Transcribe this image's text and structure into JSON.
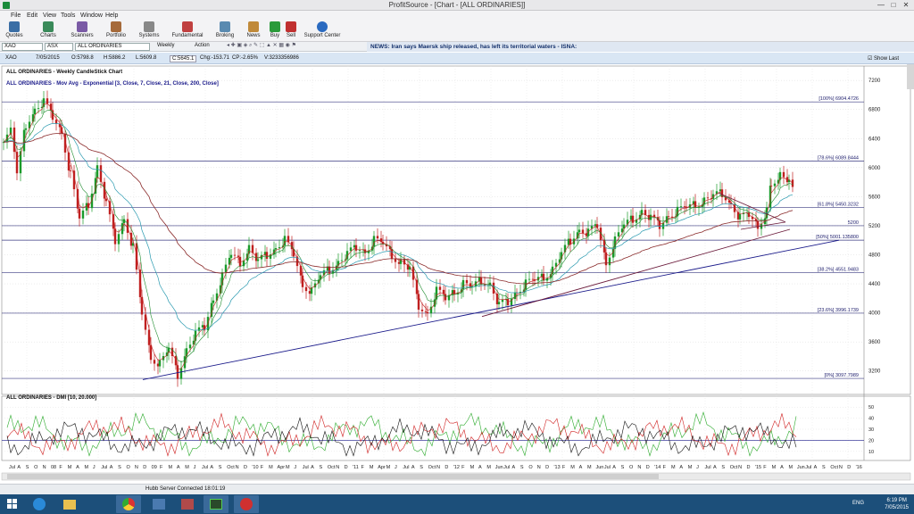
{
  "window": {
    "title": "ProfitSource - [Chart - [ALL ORDINARIES]]",
    "minimize": "—",
    "maximize": "□",
    "close": "✕"
  },
  "menu": [
    "File",
    "Edit",
    "View",
    "Tools",
    "Window",
    "Help"
  ],
  "toolbar": [
    "Quotes",
    "Charts",
    "Scanners",
    "Portfolio",
    "Systems",
    "Fundamental",
    "Broking",
    "News",
    "Buy",
    "Sell",
    "Support Center"
  ],
  "symbol_bar": {
    "symbol": "XAO",
    "exchange": "ASX",
    "name": "ALL ORDINARIES",
    "period": "Weekly",
    "action": "Action"
  },
  "news": "NEWS: Iran says Maersk ship released, has left its territorial waters - ISNA:",
  "infobar": {
    "symbol": "XAO",
    "date": "7/05/2015",
    "open": "O:5798.8",
    "high": "H:5886.2",
    "low": "L:5609.8",
    "close": "C:5645.1",
    "chg": "Chg:-153.71",
    "chgp": "CP:-2.65%",
    "vol": "V:3233356986",
    "show_last": "Show Last"
  },
  "chart_data": {
    "type": "candlestick",
    "title": "ALL ORDINARIES - Weekly CandleStick Chart",
    "indicator_label": "ALL ORDINARIES - Mov Avg - Exponential [3, Close, 7, Close, 21, Close, 200, Close]",
    "y_ticks": [
      7200,
      6800,
      6400,
      6000,
      5600,
      5200,
      4800,
      4400,
      4000,
      3600,
      3200
    ],
    "fib_levels": [
      {
        "label": "[100%] 6904.4726",
        "value": 6904.4726
      },
      {
        "label": "[78.6%] 6089.8444",
        "value": 6089.8444
      },
      {
        "label": "[61.8%] 5450.3232",
        "value": 5450.3232
      },
      {
        "label": "[50%] 5001.135800",
        "value": 5001.1358
      },
      {
        "label": "[38.2%] 4551.9483",
        "value": 4551.9483
      },
      {
        "label": "[23.6%] 3996.1739",
        "value": 3996.1739
      },
      {
        "label": "[0%] 3097.7989",
        "value": 3097.7989
      }
    ],
    "hline_label": "5200",
    "price_path": [
      [
        0,
        6350
      ],
      [
        8,
        6500
      ],
      [
        15,
        5900
      ],
      [
        25,
        6600
      ],
      [
        35,
        6800
      ],
      [
        45,
        6900
      ],
      [
        55,
        6700
      ],
      [
        65,
        6500
      ],
      [
        75,
        5900
      ],
      [
        85,
        5300
      ],
      [
        95,
        5500
      ],
      [
        105,
        6000
      ],
      [
        115,
        5500
      ],
      [
        125,
        5000
      ],
      [
        135,
        5300
      ],
      [
        145,
        4900
      ],
      [
        155,
        4000
      ],
      [
        165,
        3400
      ],
      [
        175,
        3300
      ],
      [
        185,
        3500
      ],
      [
        195,
        3150
      ],
      [
        205,
        3500
      ],
      [
        215,
        3700
      ],
      [
        225,
        3800
      ],
      [
        235,
        4200
      ],
      [
        245,
        4500
      ],
      [
        255,
        4800
      ],
      [
        265,
        4700
      ],
      [
        275,
        4900
      ],
      [
        285,
        4700
      ],
      [
        295,
        4800
      ],
      [
        305,
        4900
      ],
      [
        315,
        5000
      ],
      [
        325,
        4800
      ],
      [
        335,
        4400
      ],
      [
        345,
        4300
      ],
      [
        355,
        4500
      ],
      [
        365,
        4600
      ],
      [
        375,
        4700
      ],
      [
        385,
        4800
      ],
      [
        395,
        4900
      ],
      [
        405,
        4850
      ],
      [
        415,
        5000
      ],
      [
        425,
        4950
      ],
      [
        435,
        4800
      ],
      [
        445,
        4700
      ],
      [
        455,
        4600
      ],
      [
        465,
        4100
      ],
      [
        475,
        4000
      ],
      [
        485,
        4300
      ],
      [
        495,
        4200
      ],
      [
        505,
        4300
      ],
      [
        515,
        4400
      ],
      [
        525,
        4350
      ],
      [
        535,
        4450
      ],
      [
        545,
        4400
      ],
      [
        555,
        4100
      ],
      [
        565,
        4150
      ],
      [
        575,
        4300
      ],
      [
        585,
        4400
      ],
      [
        595,
        4450
      ],
      [
        605,
        4500
      ],
      [
        615,
        4600
      ],
      [
        625,
        4800
      ],
      [
        635,
        5000
      ],
      [
        645,
        5150
      ],
      [
        655,
        5100
      ],
      [
        665,
        5200
      ],
      [
        675,
        4700
      ],
      [
        685,
        5000
      ],
      [
        695,
        5200
      ],
      [
        705,
        5300
      ],
      [
        715,
        5400
      ],
      [
        725,
        5300
      ],
      [
        735,
        5200
      ],
      [
        745,
        5350
      ],
      [
        755,
        5400
      ],
      [
        765,
        5450
      ],
      [
        775,
        5500
      ],
      [
        785,
        5550
      ],
      [
        795,
        5600
      ],
      [
        805,
        5650
      ],
      [
        815,
        5500
      ],
      [
        825,
        5300
      ],
      [
        835,
        5350
      ],
      [
        845,
        5200
      ],
      [
        855,
        5400
      ],
      [
        860,
        5800
      ],
      [
        870,
        5900
      ],
      [
        880,
        5800
      ],
      [
        885,
        5650
      ]
    ],
    "indicator": {
      "title": "ALL ORDINARIES - DMI [10, 20.000]",
      "y_ticks": [
        50,
        40,
        30,
        20,
        10
      ]
    },
    "x_labels": [
      "Jul",
      "A",
      "S",
      "O",
      "N",
      "08",
      "F",
      "M",
      "A",
      "M",
      "J",
      "Jul",
      "A",
      "S",
      "O",
      "N",
      "D",
      "09",
      "F",
      "M",
      "A",
      "M",
      "J",
      "Jul",
      "A",
      "S",
      "Oct",
      "N",
      "D",
      "'10",
      "F",
      "M",
      "Apr",
      "M",
      "J",
      "Jul",
      "A",
      "S",
      "Oct",
      "N",
      "D",
      "'11",
      "F",
      "M",
      "Apr",
      "M",
      "J",
      "Jul",
      "A",
      "S",
      "Oct",
      "N",
      "D",
      "'12",
      "F",
      "M",
      "A",
      "M",
      "Jun",
      "Jul",
      "A",
      "S",
      "O",
      "N",
      "D",
      "'13",
      "F",
      "M",
      "A",
      "M",
      "Jun",
      "Jul",
      "A",
      "S",
      "O",
      "N",
      "D",
      "'14",
      "F",
      "M",
      "A",
      "M",
      "J",
      "Jul",
      "A",
      "S",
      "Oct",
      "N",
      "D",
      "'15",
      "F",
      "M",
      "A",
      "M",
      "Jun",
      "Jul",
      "A",
      "S",
      "Oct",
      "N",
      "D",
      "'16"
    ]
  },
  "status": "Hubb Server Connected 18:01:19",
  "clock": {
    "time": "6:19 PM",
    "date": "7/05/2015",
    "lang": "ENG"
  }
}
